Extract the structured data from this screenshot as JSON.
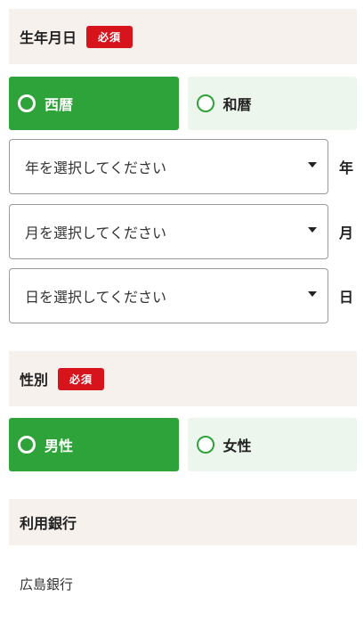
{
  "birthdate": {
    "title": "生年月日",
    "required_label": "必須",
    "calendar_options": [
      {
        "label": "西暦",
        "selected": true
      },
      {
        "label": "和暦",
        "selected": false
      }
    ],
    "year": {
      "placeholder": "年を選択してください",
      "unit": "年"
    },
    "month": {
      "placeholder": "月を選択してください",
      "unit": "月"
    },
    "day": {
      "placeholder": "日を選択してください",
      "unit": "日"
    }
  },
  "gender": {
    "title": "性別",
    "required_label": "必須",
    "options": [
      {
        "label": "男性",
        "selected": true
      },
      {
        "label": "女性",
        "selected": false
      }
    ]
  },
  "bank": {
    "title": "利用銀行",
    "value": "広島銀行"
  },
  "colors": {
    "accent": "#2ea33a",
    "accent_light": "#ecf6ed",
    "required": "#d7141c",
    "header_bg": "#f6f1ec"
  }
}
